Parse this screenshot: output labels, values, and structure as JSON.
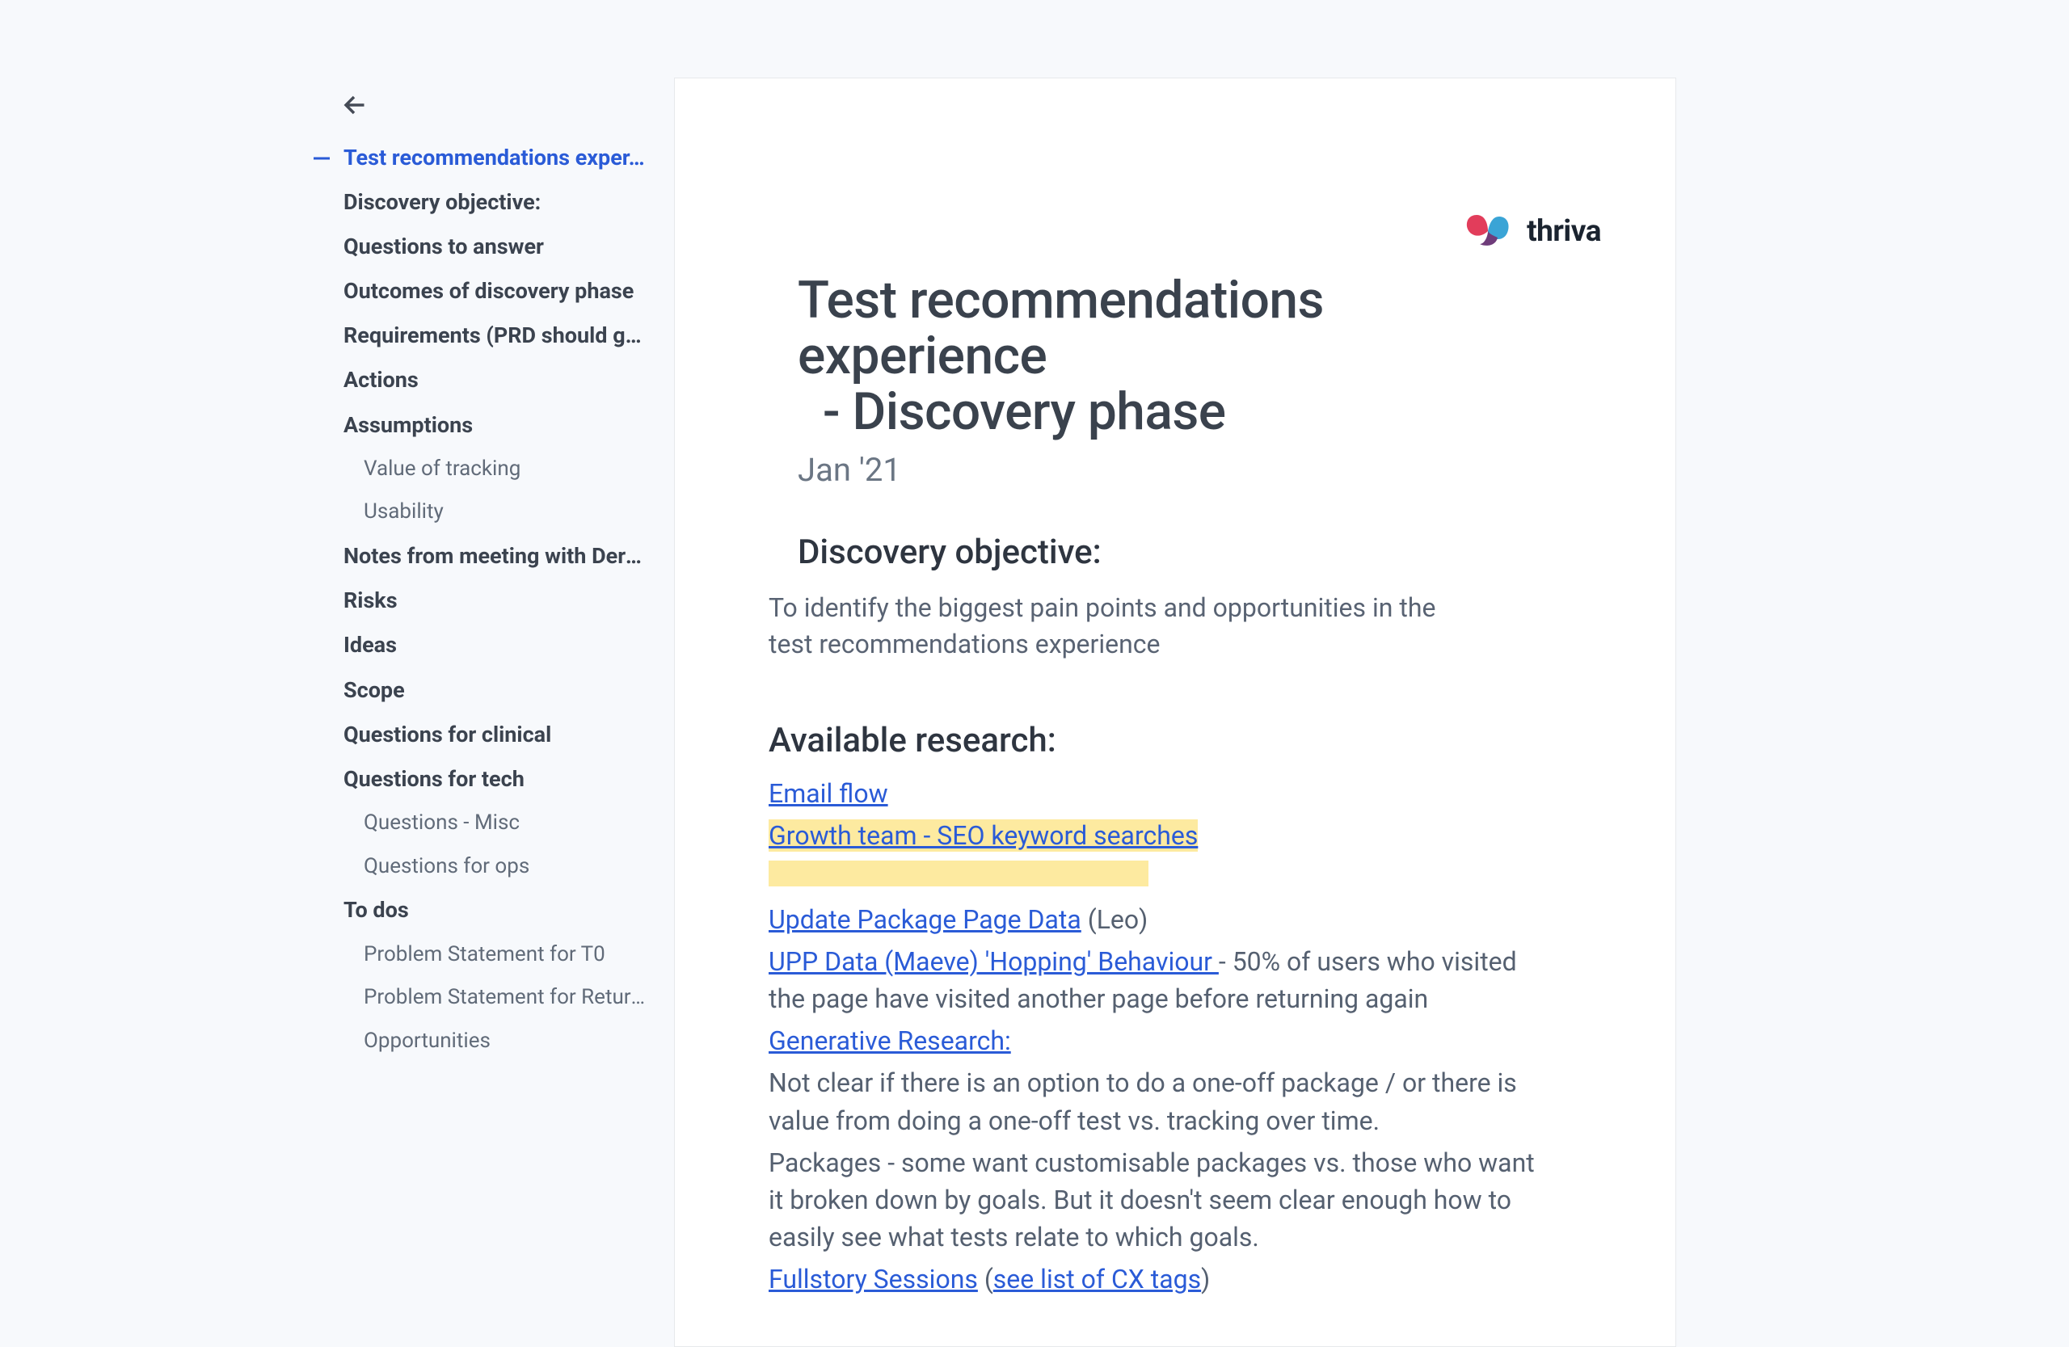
{
  "outline": {
    "root": "Test recommendations exper…",
    "items": [
      {
        "label": "Discovery objective:",
        "level": 1
      },
      {
        "label": "Questions to answer",
        "level": 1
      },
      {
        "label": "Outcomes of discovery phase",
        "level": 1
      },
      {
        "label": "Requirements (PRD should gi…",
        "level": 1
      },
      {
        "label": "Actions",
        "level": 1
      },
      {
        "label": "Assumptions",
        "level": 1
      },
      {
        "label": "Value of tracking",
        "level": 2
      },
      {
        "label": "Usability",
        "level": 2
      },
      {
        "label": "Notes from meeting with Derek",
        "level": 1
      },
      {
        "label": "Risks",
        "level": 1
      },
      {
        "label": "Ideas",
        "level": 1
      },
      {
        "label": "Scope",
        "level": 1
      },
      {
        "label": "Questions for clinical",
        "level": 1
      },
      {
        "label": "Questions for tech",
        "level": 1
      },
      {
        "label": "Questions - Misc",
        "level": 2
      },
      {
        "label": "Questions for ops",
        "level": 2
      },
      {
        "label": "To dos",
        "level": 1
      },
      {
        "label": "Problem Statement for T0",
        "level": 2
      },
      {
        "label": "Problem Statement for Returnin…",
        "level": 2
      },
      {
        "label": "Opportunities",
        "level": 2
      }
    ]
  },
  "brand": {
    "text": "thriva"
  },
  "doc": {
    "title_line1": "Test recommendations experience",
    "title_line2": "- Discovery phase",
    "date": "Jan '21",
    "objective_heading": "Discovery objective:",
    "objective_body": "To identify the biggest pain points and opportunities in the test recommendations experience",
    "research_heading": "Available research:",
    "links": {
      "email_flow": "Email flow",
      "growth_seo": "Growth team - SEO keyword searches",
      "update_pkg": "Update Package Page Data",
      "update_pkg_suffix": "(Leo)",
      "upp_data": "UPP Data (Maeve) 'Hopping' Behaviour ",
      "upp_suffix": "- 50% of users who visited the page have visited another page before returning again",
      "generative": "Generative Research:",
      "gen_body1": "Not clear if there is an option to do a one-off package / or there is value from doing a one-off test vs. tracking over time.",
      "gen_body2": "Packages - some want customisable packages vs. those who want it broken down by goals. But it doesn't seem clear enough how to easily see what tests relate to which goals.",
      "fullstory": "Fullstory Sessions",
      "fullstory_mid_open": "(",
      "fullstory_inner": "see list of CX tags",
      "fullstory_mid_close": ")"
    }
  }
}
